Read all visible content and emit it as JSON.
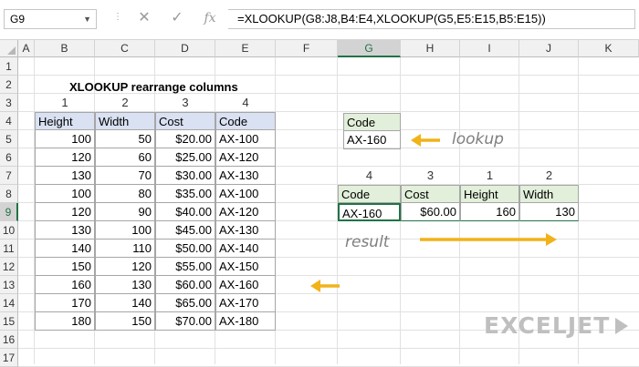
{
  "formula_bar": {
    "name_box": "G9",
    "cancel_icon": "✕",
    "enter_icon": "✓",
    "function_icon": "fx",
    "formula": "=XLOOKUP(G8:J8,B4:E4,XLOOKUP(G5,E5:E15,B5:E15))"
  },
  "columns": [
    "A",
    "B",
    "C",
    "D",
    "E",
    "F",
    "G",
    "H",
    "I",
    "J",
    "K"
  ],
  "rows": [
    "1",
    "2",
    "3",
    "4",
    "5",
    "6",
    "7",
    "8",
    "9",
    "10",
    "11",
    "12",
    "13",
    "14",
    "15",
    "16",
    "17"
  ],
  "selected_cell": {
    "column": "G",
    "row": "9"
  },
  "title": "XLOOKUP rearrange columns",
  "source_indices": [
    "1",
    "2",
    "3",
    "4"
  ],
  "source_table": {
    "headers": [
      "Height",
      "Width",
      "Cost",
      "Code"
    ],
    "rows": [
      [
        "100",
        "50",
        "$20.00",
        "AX-100"
      ],
      [
        "120",
        "60",
        "$25.00",
        "AX-120"
      ],
      [
        "130",
        "70",
        "$30.00",
        "AX-130"
      ],
      [
        "100",
        "80",
        "$35.00",
        "AX-100"
      ],
      [
        "120",
        "90",
        "$40.00",
        "AX-120"
      ],
      [
        "130",
        "100",
        "$45.00",
        "AX-130"
      ],
      [
        "140",
        "110",
        "$50.00",
        "AX-140"
      ],
      [
        "150",
        "120",
        "$55.00",
        "AX-150"
      ],
      [
        "160",
        "130",
        "$60.00",
        "AX-160"
      ],
      [
        "170",
        "140",
        "$65.00",
        "AX-170"
      ],
      [
        "180",
        "150",
        "$70.00",
        "AX-180"
      ]
    ]
  },
  "lookup": {
    "label": "Code",
    "value": "AX-160",
    "annotation": "lookup"
  },
  "result_indices": [
    "4",
    "3",
    "1",
    "2"
  ],
  "result_table": {
    "headers": [
      "Code",
      "Cost",
      "Height",
      "Width"
    ],
    "values": [
      "AX-160",
      "$60.00",
      "160",
      "130"
    ]
  },
  "result_annotation": "result",
  "logo": "EXCELJET",
  "colors": {
    "accent": "#217346",
    "arrow": "#f2b21a",
    "header_blue": "#d9e1f2",
    "header_green": "#e2efda"
  }
}
